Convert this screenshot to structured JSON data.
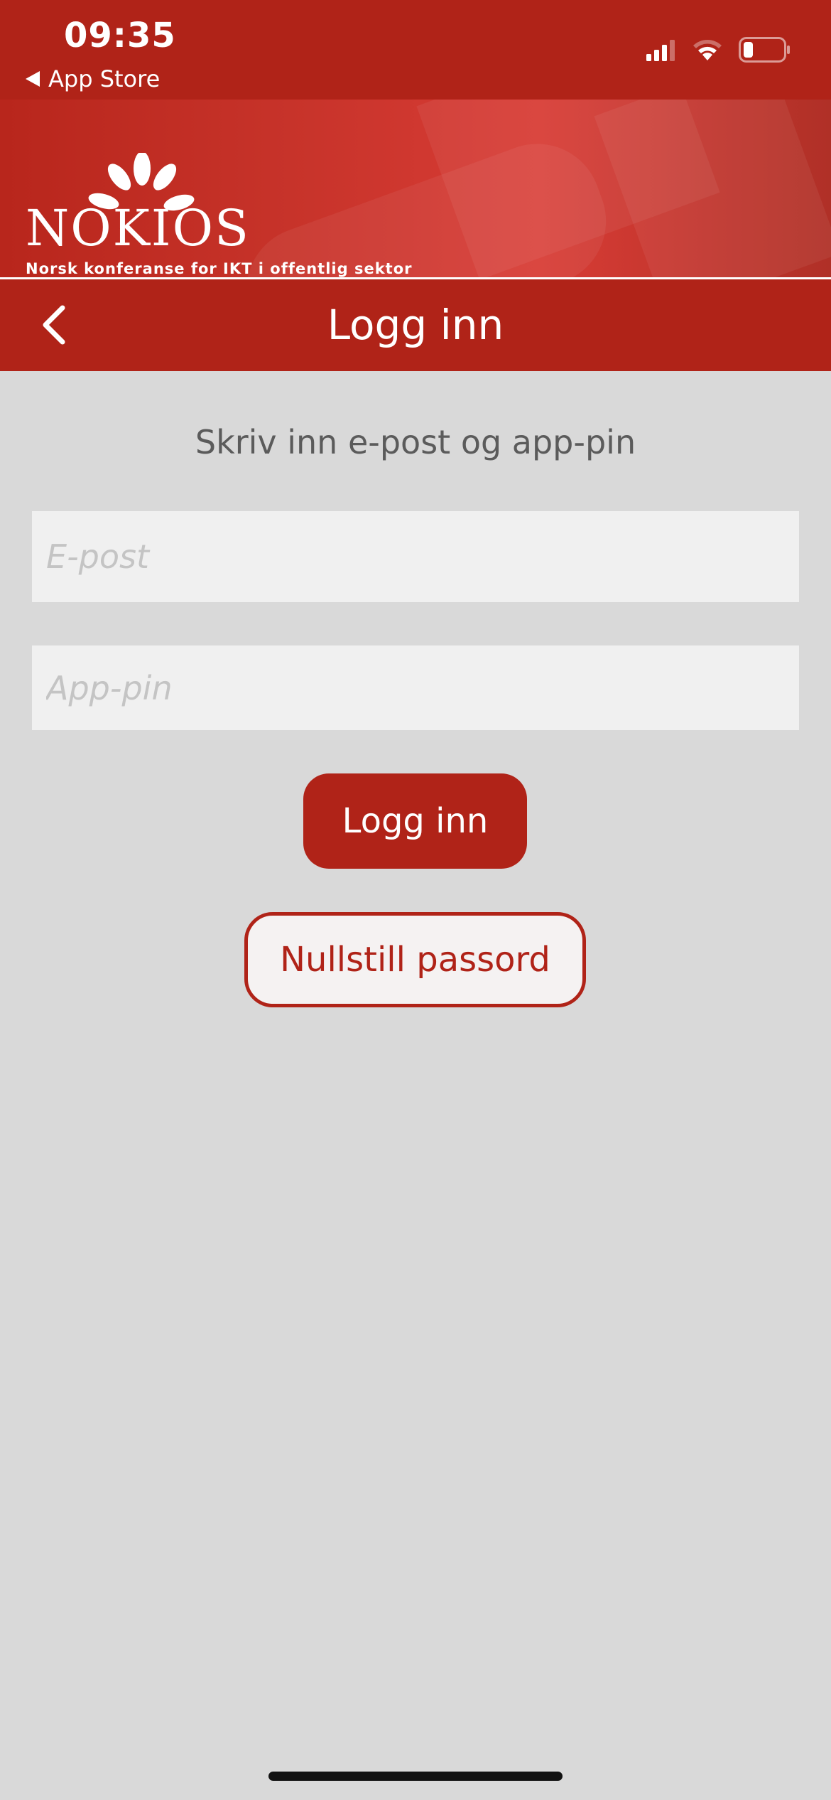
{
  "status_bar": {
    "time": "09:35",
    "back_app_label": "App Store"
  },
  "banner": {
    "logo_word": "NOKIOS",
    "tagline": "Norsk konferanse for IKT i offentlig sektor"
  },
  "nav": {
    "title": "Logg inn"
  },
  "form": {
    "instruction": "Skriv inn e-post og app-pin",
    "email_placeholder": "E-post",
    "pin_placeholder": "App-pin",
    "login_label": "Logg inn",
    "reset_label": "Nullstill passord"
  },
  "colors": {
    "brand_red": "#b02318",
    "background": "#d9d9d9",
    "field_background": "#f0f0f0"
  }
}
